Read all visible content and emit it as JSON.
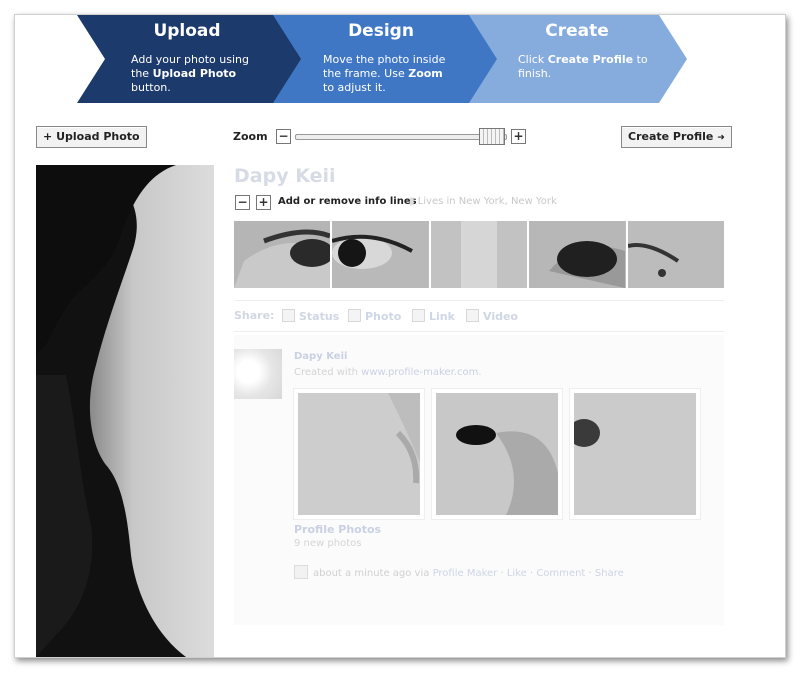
{
  "steps": [
    {
      "title": "Upload",
      "desc_pre": "Add your photo using the ",
      "desc_bold": "Upload Photo",
      "desc_post": " button.",
      "color": "#1c3a6b"
    },
    {
      "title": "Design",
      "desc_pre": "Move the photo inside the frame. Use ",
      "desc_bold": "Zoom",
      "desc_post": " to adjust it.",
      "color": "#3f77c5"
    },
    {
      "title": "Create",
      "desc_pre": "Click ",
      "desc_bold": "Create Profile",
      "desc_post": " to finish.",
      "color": "#86acde"
    }
  ],
  "toolbar": {
    "upload_label": "Upload Photo",
    "upload_icon": "+",
    "zoom_label": "Zoom",
    "zoom_minus": "−",
    "zoom_plus": "+",
    "create_label": "Create Profile",
    "create_icon": "➜"
  },
  "profile": {
    "name": "Dapy Keii",
    "info_minus": "−",
    "info_plus": "+",
    "info_label": "Add or remove info lines",
    "lives_in": "Lives in New York, New York"
  },
  "share": {
    "label": "Share:",
    "items": [
      "Status",
      "Photo",
      "Link",
      "Video"
    ]
  },
  "feed": {
    "name": "Dapy Keii",
    "created_pre": "Created with ",
    "created_link": "www.profile-maker.com",
    "created_post": ".",
    "album_title": "Profile Photos",
    "album_count": "9 new photos",
    "time": "about a minute ago via ",
    "via": "Profile Maker",
    "sep": " · ",
    "like": "Like",
    "comment": "Comment",
    "share": "Share"
  }
}
